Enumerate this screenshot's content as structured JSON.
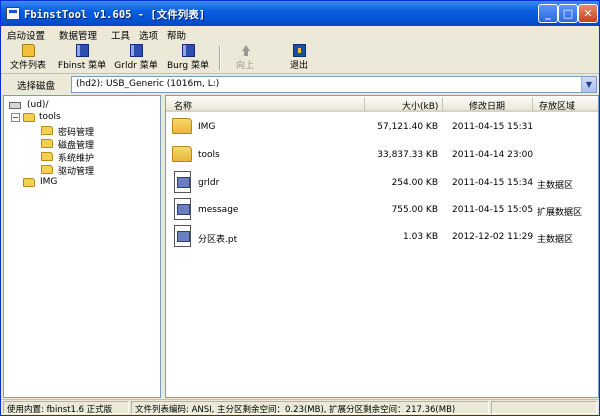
{
  "window": {
    "title": "FbinstTool v1.605 - [文件列表]",
    "buttons": {
      "minimize": "_",
      "maximize": "□",
      "close": "✕"
    }
  },
  "menu": [
    "启动设置",
    "数据管理",
    "工具",
    "选项",
    "帮助"
  ],
  "toolbar": [
    {
      "label": "文件列表",
      "icon": "folder-icon"
    },
    {
      "label": "Fbinst 菜单",
      "icon": "menu-book-icon"
    },
    {
      "label": "Grldr 菜单",
      "icon": "menu-book-icon"
    },
    {
      "label": "Burg 菜单",
      "icon": "menu-book-icon"
    },
    {
      "label": "向上",
      "icon": "up-arrow-icon",
      "disabled": true
    },
    {
      "label": "退出",
      "icon": "exit-icon"
    }
  ],
  "disk": {
    "label": "选择磁盘",
    "selected": "(hd2): USB_Generic  (1016m, L:)"
  },
  "tree": {
    "root": "(ud)/",
    "tools": "tools",
    "children": [
      "密码管理",
      "磁盘管理",
      "系统维护",
      "驱动管理"
    ],
    "img": "IMG"
  },
  "columns": {
    "name": "名称",
    "size": "大小(kB)",
    "date": "修改日期",
    "area": "存放区域"
  },
  "files": [
    {
      "name": "IMG",
      "size": "57,121.40 KB",
      "date": "2011-04-15 15:31",
      "area": "",
      "type": "folder"
    },
    {
      "name": "tools",
      "size": "33,837.33 KB",
      "date": "2011-04-14 23:00",
      "area": "",
      "type": "folder"
    },
    {
      "name": "grldr",
      "size": "254.00 KB",
      "date": "2011-04-15 15:34",
      "area": "主数据区",
      "type": "file"
    },
    {
      "name": "message",
      "size": "755.00 KB",
      "date": "2011-04-15 15:05",
      "area": "扩展数据区",
      "type": "file"
    },
    {
      "name": "分区表.pt",
      "size": "1.03 KB",
      "date": "2012-12-02 11:29",
      "area": "主数据区",
      "type": "file"
    }
  ],
  "status": {
    "version": "使用内置: fbinst1.6 正式版",
    "info": "文件列表编码: ANSI, 主分区剩余空间：0.23(MB), 扩展分区剩余空间：217.36(MB)"
  }
}
